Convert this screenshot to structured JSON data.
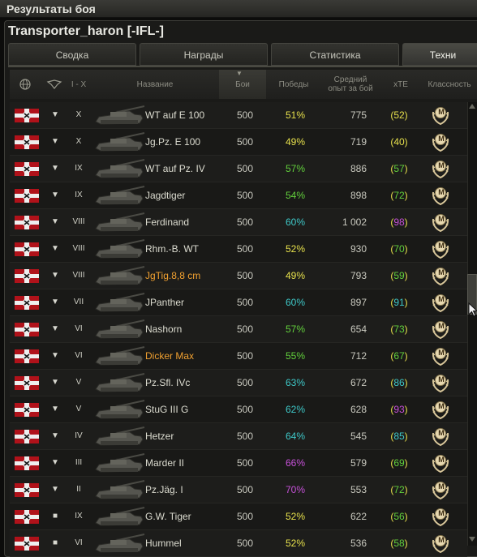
{
  "window": {
    "title": "Результаты боя"
  },
  "player": {
    "name": "Transporter_haron [-IFL-]"
  },
  "tabs": [
    {
      "label": "Сводка",
      "active": false
    },
    {
      "label": "Награды",
      "active": false
    },
    {
      "label": "Статистика",
      "active": false
    },
    {
      "label": "Техни",
      "active": true
    }
  ],
  "columns": {
    "nation_icon": "globe-icon",
    "type_icon": "tank-type-icon",
    "tier": "I - X",
    "name": "Название",
    "battles": "Бои",
    "wins": "Победы",
    "avg_xp_line1": "Средний",
    "avg_xp_line2": "опыт за бой",
    "xte": "xTE",
    "mastery": "Классность"
  },
  "colors": {
    "premium_name": "#f0a030",
    "wins_yellow": "#e6e04c",
    "wins_green": "#62d03c",
    "wins_teal": "#3ec8c8",
    "wins_purple": "#c651d8",
    "xte_yellow": "#e6e04c",
    "xte_green": "#62d03c",
    "xte_teal": "#3ec8c8",
    "xte_purple": "#c651d8"
  },
  "rows": [
    {
      "type": "▼",
      "tier": "X",
      "name": "WT auf E 100",
      "premium": false,
      "battles": "500",
      "wins": "51%",
      "wins_color": "#e6e04c",
      "avg": "775",
      "xte_open": "(",
      "xte": "52",
      "xte_close": ")",
      "xte_color": "#e6e04c",
      "mastery": "M"
    },
    {
      "type": "▼",
      "tier": "X",
      "name": "Jg.Pz. E 100",
      "premium": false,
      "battles": "500",
      "wins": "49%",
      "wins_color": "#e6e04c",
      "avg": "719",
      "xte_open": "(",
      "xte": "40",
      "xte_close": ")",
      "xte_color": "#e6e04c",
      "mastery": "M"
    },
    {
      "type": "▼",
      "tier": "IX",
      "name": "WT auf Pz. IV",
      "premium": false,
      "battles": "500",
      "wins": "57%",
      "wins_color": "#62d03c",
      "avg": "886",
      "xte_open": "(",
      "xte": "57",
      "xte_close": ")",
      "xte_color": "#62d03c",
      "mastery": "M"
    },
    {
      "type": "▼",
      "tier": "IX",
      "name": "Jagdtiger",
      "premium": false,
      "battles": "500",
      "wins": "54%",
      "wins_color": "#62d03c",
      "avg": "898",
      "xte_open": "(",
      "xte": "72",
      "xte_close": ")",
      "xte_color": "#62d03c",
      "mastery": "M"
    },
    {
      "type": "▼",
      "tier": "VIII",
      "name": "Ferdinand",
      "premium": false,
      "battles": "500",
      "wins": "60%",
      "wins_color": "#3ec8c8",
      "avg": "1 002",
      "xte_open": "(",
      "xte": "98",
      "xte_close": ")",
      "xte_color": "#c651d8",
      "mastery": "M"
    },
    {
      "type": "▼",
      "tier": "VIII",
      "name": "Rhm.-B. WT",
      "premium": false,
      "battles": "500",
      "wins": "52%",
      "wins_color": "#e6e04c",
      "avg": "930",
      "xte_open": "(",
      "xte": "70",
      "xte_close": ")",
      "xte_color": "#62d03c",
      "mastery": "M"
    },
    {
      "type": "▼",
      "tier": "VIII",
      "name": "JgTig.8,8 cm",
      "premium": true,
      "battles": "500",
      "wins": "49%",
      "wins_color": "#e6e04c",
      "avg": "793",
      "xte_open": "(",
      "xte": "59",
      "xte_close": ")",
      "xte_color": "#62d03c",
      "mastery": "M"
    },
    {
      "type": "▼",
      "tier": "VII",
      "name": "JPanther",
      "premium": false,
      "battles": "500",
      "wins": "60%",
      "wins_color": "#3ec8c8",
      "avg": "897",
      "xte_open": "(",
      "xte": "91",
      "xte_close": ")",
      "xte_color": "#3ec8c8",
      "mastery": "M"
    },
    {
      "type": "▼",
      "tier": "VI",
      "name": "Nashorn",
      "premium": false,
      "battles": "500",
      "wins": "57%",
      "wins_color": "#62d03c",
      "avg": "654",
      "xte_open": "(",
      "xte": "73",
      "xte_close": ")",
      "xte_color": "#62d03c",
      "mastery": "M"
    },
    {
      "type": "▼",
      "tier": "VI",
      "name": "Dicker Max",
      "premium": true,
      "battles": "500",
      "wins": "55%",
      "wins_color": "#62d03c",
      "avg": "712",
      "xte_open": "(",
      "xte": "67",
      "xte_close": ")",
      "xte_color": "#62d03c",
      "mastery": "M"
    },
    {
      "type": "▼",
      "tier": "V",
      "name": "Pz.Sfl. IVc",
      "premium": false,
      "battles": "500",
      "wins": "63%",
      "wins_color": "#3ec8c8",
      "avg": "672",
      "xte_open": "(",
      "xte": "86",
      "xte_close": ")",
      "xte_color": "#3ec8c8",
      "mastery": "M"
    },
    {
      "type": "▼",
      "tier": "V",
      "name": "StuG III G",
      "premium": false,
      "battles": "500",
      "wins": "62%",
      "wins_color": "#3ec8c8",
      "avg": "628",
      "xte_open": "(",
      "xte": "93",
      "xte_close": ")",
      "xte_color": "#c651d8",
      "mastery": "M"
    },
    {
      "type": "▼",
      "tier": "IV",
      "name": "Hetzer",
      "premium": false,
      "battles": "500",
      "wins": "64%",
      "wins_color": "#3ec8c8",
      "avg": "545",
      "xte_open": "(",
      "xte": "85",
      "xte_close": ")",
      "xte_color": "#3ec8c8",
      "mastery": "M"
    },
    {
      "type": "▼",
      "tier": "III",
      "name": "Marder II",
      "premium": false,
      "battles": "500",
      "wins": "66%",
      "wins_color": "#c651d8",
      "avg": "579",
      "xte_open": "(",
      "xte": "69",
      "xte_close": ")",
      "xte_color": "#62d03c",
      "mastery": "M"
    },
    {
      "type": "▼",
      "tier": "II",
      "name": "Pz.Jäg. I",
      "premium": false,
      "battles": "500",
      "wins": "70%",
      "wins_color": "#c651d8",
      "avg": "553",
      "xte_open": "(",
      "xte": "72",
      "xte_close": ")",
      "xte_color": "#62d03c",
      "mastery": "M"
    },
    {
      "type": "■",
      "tier": "IX",
      "name": "G.W. Tiger",
      "premium": false,
      "battles": "500",
      "wins": "52%",
      "wins_color": "#e6e04c",
      "avg": "622",
      "xte_open": "(",
      "xte": "56",
      "xte_close": ")",
      "xte_color": "#62d03c",
      "mastery": "M"
    },
    {
      "type": "■",
      "tier": "VI",
      "name": "Hummel",
      "premium": false,
      "battles": "500",
      "wins": "52%",
      "wins_color": "#e6e04c",
      "avg": "536",
      "xte_open": "(",
      "xte": "58",
      "xte_close": ")",
      "xte_color": "#62d03c",
      "mastery": "M"
    }
  ],
  "icons": {
    "nation_flag": "german-flag-icon",
    "mastery_badge": "mastery-badge-icon",
    "tank": "tank-silhouette-icon"
  }
}
